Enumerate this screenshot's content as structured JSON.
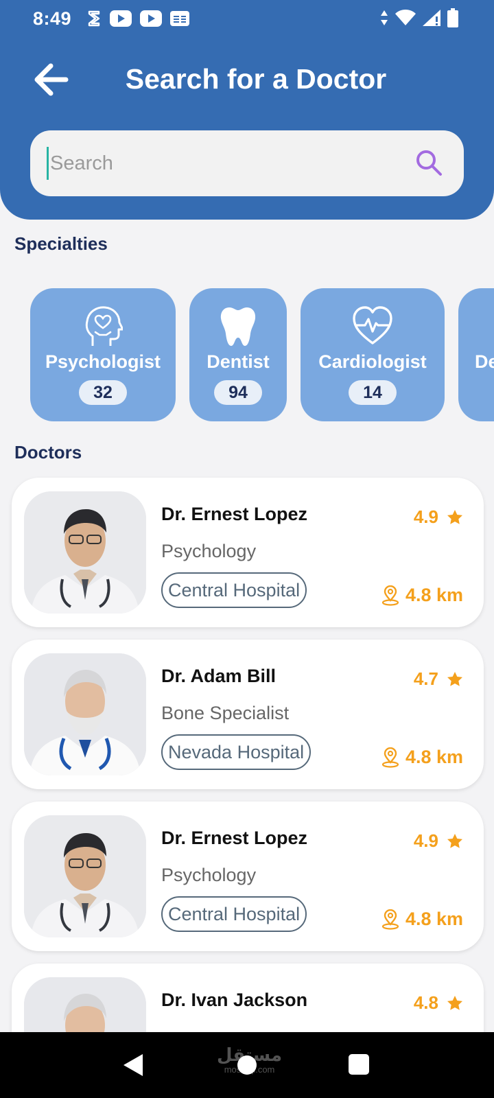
{
  "status_bar": {
    "time": "8:49",
    "left_icons": [
      "notification-icon",
      "youtube-icon",
      "youtube-icon",
      "news-icon"
    ],
    "right_icons": [
      "data-arrows-icon",
      "wifi-icon",
      "signal-icon",
      "battery-icon"
    ]
  },
  "header": {
    "title": "Search for a Doctor",
    "back_icon": "arrow-left-icon",
    "background_color": "#356cb2"
  },
  "search": {
    "placeholder": "Search",
    "value": "",
    "icon": "search-icon",
    "icon_color": "#a36be0"
  },
  "specialties": {
    "title": "Specialties",
    "card_color": "#7aa8e0",
    "items": [
      {
        "label": "Psychologist",
        "count": "32",
        "icon": "head-heart-icon"
      },
      {
        "label": "Dentist",
        "count": "94",
        "icon": "tooth-icon"
      },
      {
        "label": "Cardiologist",
        "count": "14",
        "icon": "heartbeat-icon"
      },
      {
        "label": "De",
        "count": "",
        "icon": ""
      }
    ]
  },
  "doctors": {
    "title": "Doctors",
    "accent_color": "#f4a01c",
    "items": [
      {
        "name": "Dr. Ernest Lopez",
        "specialty": "Psychology",
        "hospital": "Central Hospital",
        "rating": "4.9",
        "distance": "4.8 km",
        "avatar": "young-doctor-photo"
      },
      {
        "name": "Dr. Adam Bill",
        "specialty": "Bone Specialist",
        "hospital": "Nevada Hospital",
        "rating": "4.7",
        "distance": "4.8 km",
        "avatar": "senior-doctor-photo"
      },
      {
        "name": "Dr. Ernest Lopez",
        "specialty": "Psychology",
        "hospital": "Central Hospital",
        "rating": "4.9",
        "distance": "4.8 km",
        "avatar": "young-doctor-photo"
      },
      {
        "name": "Dr. Ivan Jackson",
        "specialty": "",
        "hospital": "",
        "rating": "4.8",
        "distance": "",
        "avatar": "senior-doctor-photo"
      }
    ]
  },
  "nav_bar": {
    "buttons": [
      "back-triangle-icon",
      "home-circle-icon",
      "recents-square-icon"
    ],
    "watermark": "مستقل",
    "watermark_sub": "mostaql.com"
  }
}
